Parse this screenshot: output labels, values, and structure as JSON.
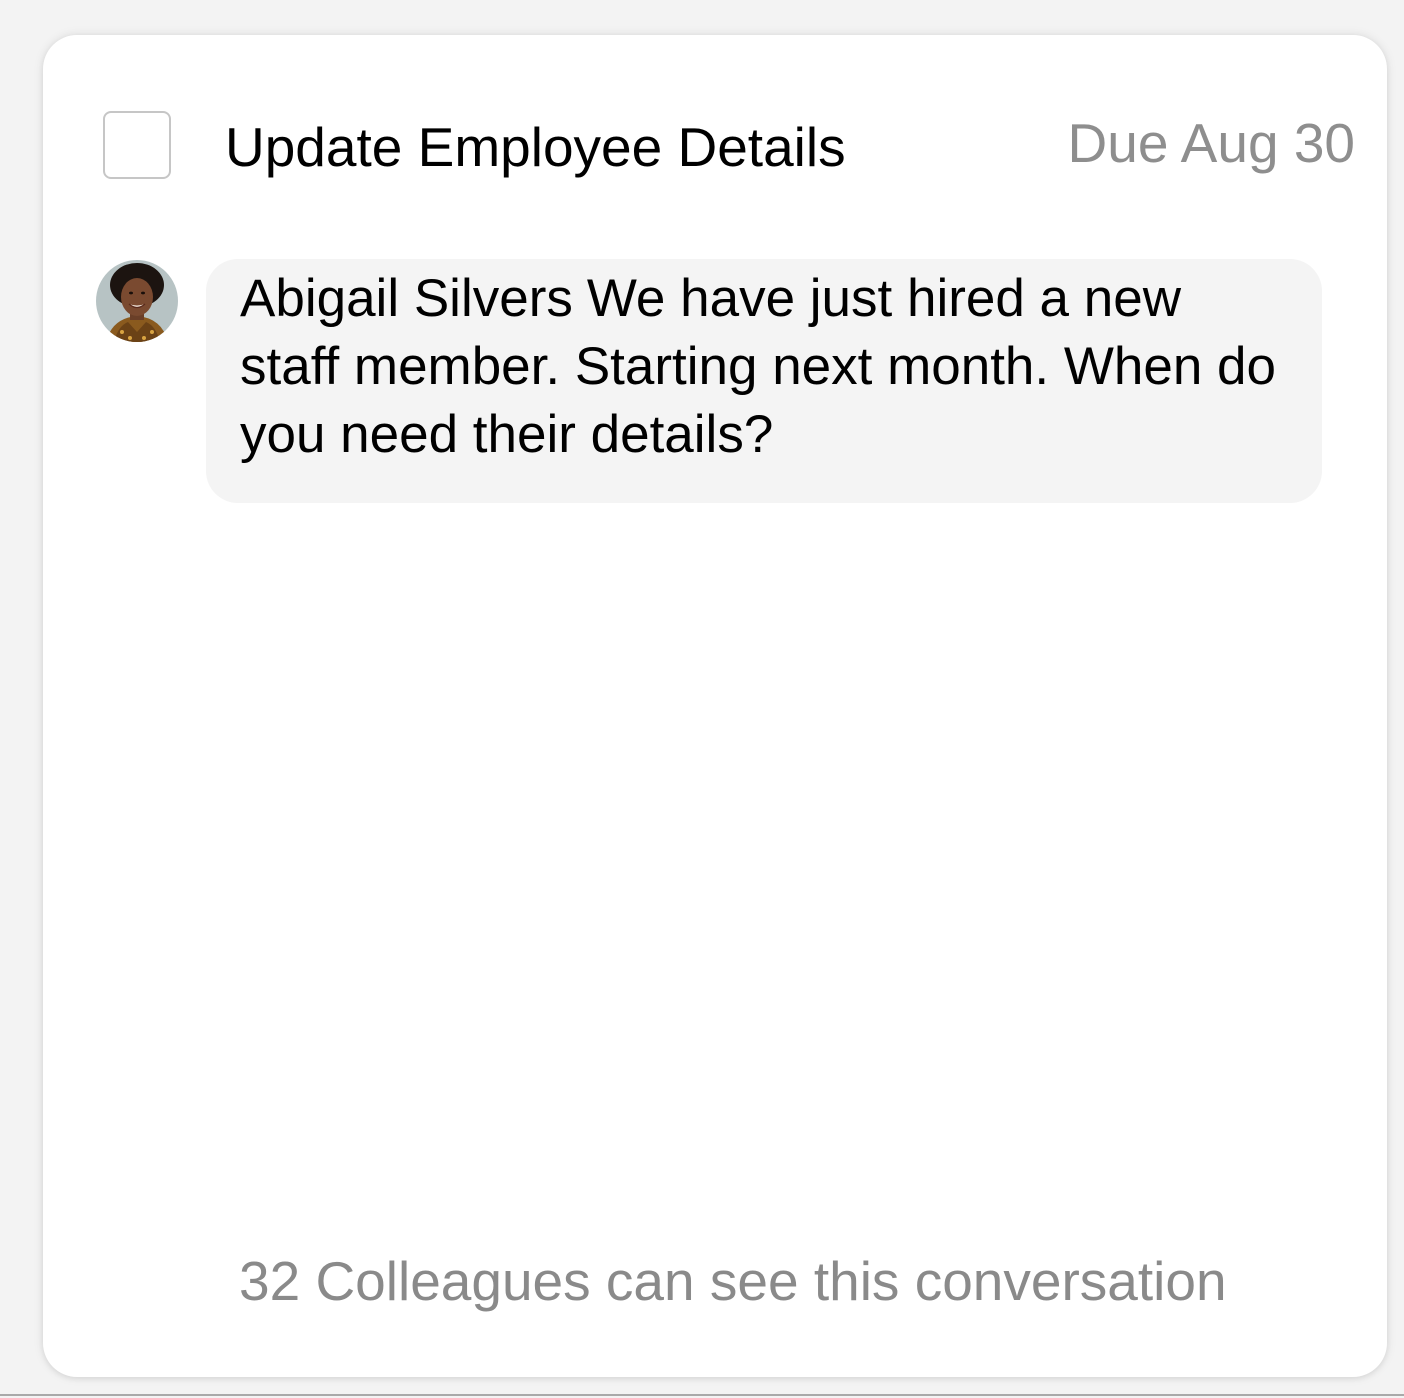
{
  "task": {
    "title": "Update Employee Details",
    "due": "Due Aug 30",
    "completed": false
  },
  "comment": {
    "author": "Abigail Silvers",
    "message": "We have just hired a new staff member. Starting next month. When do you need their details?",
    "avatar_icon": "user-avatar-photo"
  },
  "footer": {
    "visibility_text": "32 Colleagues can see this conversation"
  },
  "colors": {
    "card_background": "#ffffff",
    "bubble_background": "#f4f4f4",
    "muted_text": "#8e8e8e"
  }
}
